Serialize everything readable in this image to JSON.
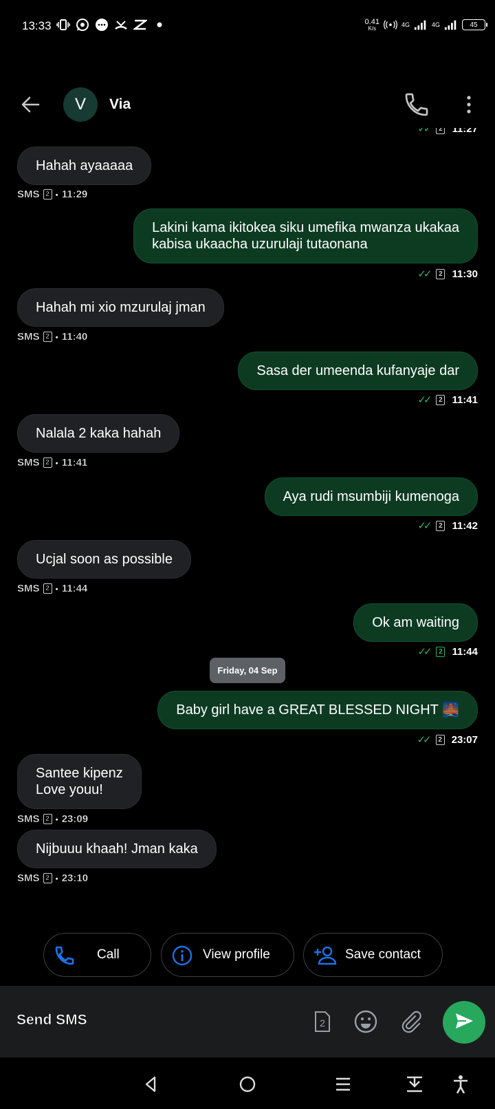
{
  "status_bar": {
    "time": "13:33",
    "speed_value": "0.41",
    "speed_unit": "K/s",
    "net1": "4G",
    "net2": "4G",
    "battery": "45"
  },
  "header": {
    "avatar_letter": "V",
    "contact_name": "Via"
  },
  "messages": [
    {
      "dir": "in",
      "lines": [
        "Hahah ayaaaaa"
      ],
      "sms": "SMS",
      "sim": "2",
      "time": "11:29"
    },
    {
      "dir": "out",
      "lines": [
        "Lakini kama ikitokea siku umefika mwanza ukakaa",
        "kabisa ukaacha uzurulaji tutaonana"
      ],
      "sim": "2",
      "time": "11:30"
    },
    {
      "dir": "in",
      "lines": [
        "Hahah mi xio mzurulaj jman"
      ],
      "sms": "SMS",
      "sim": "2",
      "time": "11:40"
    },
    {
      "dir": "out",
      "lines": [
        "Sasa der umeenda kufanyaje dar"
      ],
      "sim": "2",
      "time": "11:41"
    },
    {
      "dir": "in",
      "lines": [
        "Nalala 2 kaka hahah"
      ],
      "sms": "SMS",
      "sim": "2",
      "time": "11:41"
    },
    {
      "dir": "out",
      "lines": [
        "Aya rudi msumbiji kumenoga"
      ],
      "sim": "2",
      "time": "11:42"
    },
    {
      "dir": "in",
      "lines": [
        "Ucjal soon as possible"
      ],
      "sms": "SMS",
      "sim": "2",
      "time": "11:44"
    },
    {
      "dir": "out",
      "lines": [
        "Ok am waiting"
      ],
      "sim": "2",
      "time": "11:44"
    },
    {
      "dir": "out",
      "lines": [
        "Baby girl have a GREAT BLESSED NIGHT 🌉"
      ],
      "sim": "2",
      "time": "23:07"
    },
    {
      "dir": "in",
      "lines": [
        "Santee kipenz",
        "Love youu!"
      ],
      "sms": "SMS",
      "sim": "2",
      "time": "23:09"
    },
    {
      "dir": "in",
      "lines": [
        "Nijbuuu khaah! Jman kaka"
      ],
      "sms": "SMS",
      "sim": "2",
      "time": "23:10"
    }
  ],
  "top_partial": {
    "sim": "2",
    "time": "11:27"
  },
  "date_separator": "Friday, 04 Sep",
  "actions": {
    "call": "Call",
    "view_profile": "View profile",
    "save_contact": "Save contact"
  },
  "compose": {
    "placeholder": "Send SMS",
    "sim": "2"
  },
  "colors": {
    "incoming_bubble": "#1f2124",
    "outgoing_bubble": "#0d3b22",
    "accent_blue": "#1a73e8",
    "accent_green": "#27a85c"
  }
}
